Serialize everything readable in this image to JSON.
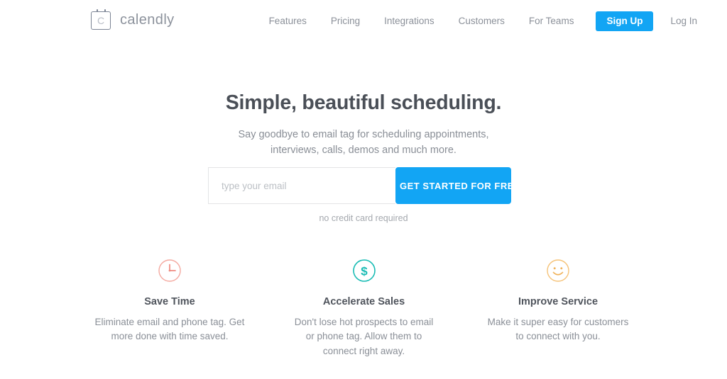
{
  "brand": {
    "name": "calendly",
    "logo_letter": "C",
    "logo_icon": "calendar-icon"
  },
  "nav": {
    "links": [
      {
        "label": "Features"
      },
      {
        "label": "Pricing"
      },
      {
        "label": "Integrations"
      },
      {
        "label": "Customers"
      },
      {
        "label": "For Teams"
      }
    ],
    "signup_label": "Sign Up",
    "login_label": "Log In"
  },
  "hero": {
    "title": "Simple, beautiful scheduling.",
    "subtitle": "Say goodbye to email tag for scheduling appointments, interviews, calls, demos and much more."
  },
  "signup": {
    "email_value": "",
    "email_placeholder": "type your email",
    "cta_label": "GET STARTED FOR FREE",
    "note": "no credit card required"
  },
  "features": [
    {
      "icon": "clock-icon",
      "title": "Save Time",
      "description": "Eliminate email and phone tag. Get more done with time saved."
    },
    {
      "icon": "dollar-circle-icon",
      "title": "Accelerate Sales",
      "description": "Don't lose hot prospects to email or phone tag. Allow them to connect right away."
    },
    {
      "icon": "smiley-face-icon",
      "title": "Improve Service",
      "description": "Make it super easy for customers to connect with you."
    }
  ],
  "colors": {
    "accent_blue": "#12a5f4",
    "heading_gray": "#4a4f57",
    "body_gray": "#898e96",
    "clock_coral": "#f4a9a0",
    "dollar_teal": "#19bcb4",
    "smiley_orange": "#f5c277"
  }
}
